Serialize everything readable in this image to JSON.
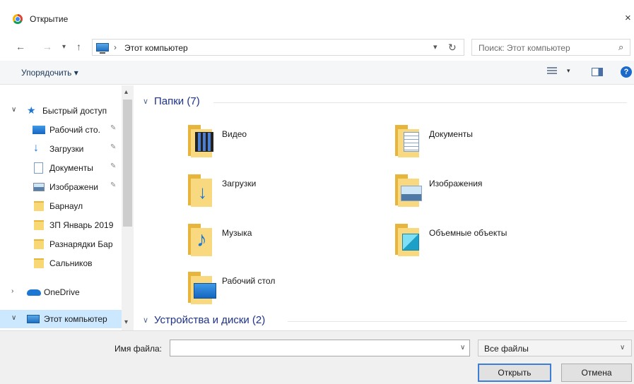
{
  "window": {
    "title": "Открытие",
    "close_glyph": "×"
  },
  "nav": {
    "back": "←",
    "forward": "→",
    "recent": "▾",
    "up": "↑"
  },
  "address": {
    "separator": "›",
    "crumb": "Этот компьютер",
    "chevron": "▾",
    "refresh": "↻"
  },
  "search": {
    "placeholder": "Поиск: Этот компьютер",
    "icon_glyph": "⌕"
  },
  "toolbar": {
    "organize_label": "Упорядочить ▾",
    "help_glyph": "?",
    "view_drop": "▾"
  },
  "sidebar": {
    "quick_access": {
      "label": "Быстрый доступ",
      "expander": "∨"
    },
    "items": [
      {
        "label": "Рабочий сто.",
        "icon": "desktop-icon",
        "pinned": true
      },
      {
        "label": "Загрузки",
        "icon": "downloads-icon",
        "pinned": true
      },
      {
        "label": "Документы",
        "icon": "documents-icon",
        "pinned": true
      },
      {
        "label": "Изображени",
        "icon": "pictures-icon",
        "pinned": true
      },
      {
        "label": "Барнаул",
        "icon": "folder-icon",
        "pinned": false
      },
      {
        "label": "ЗП Январь 2019",
        "icon": "folder-icon",
        "pinned": false
      },
      {
        "label": "Разнарядки Бар",
        "icon": "folder-icon",
        "pinned": false
      },
      {
        "label": "Сальников",
        "icon": "folder-icon",
        "pinned": false
      }
    ],
    "pin_glyph": "📌",
    "onedrive": {
      "label": "OneDrive",
      "expander": "›"
    },
    "this_pc": {
      "label": "Этот компьютер",
      "expander": "∨",
      "selected": true
    },
    "scroll_up": "▴",
    "scroll_down": "▾"
  },
  "content": {
    "folders_header": "Папки (7)",
    "devices_header": "Устройства и диски (2)",
    "collapse_glyph": "∨",
    "folders": [
      {
        "name": "Видео",
        "icon": "videos-folder-icon"
      },
      {
        "name": "Документы",
        "icon": "documents-folder-icon"
      },
      {
        "name": "Загрузки",
        "icon": "downloads-folder-icon"
      },
      {
        "name": "Изображения",
        "icon": "pictures-folder-icon"
      },
      {
        "name": "Музыка",
        "icon": "music-folder-icon"
      },
      {
        "name": "Объемные объекты",
        "icon": "3d-objects-folder-icon"
      },
      {
        "name": "Рабочий стол",
        "icon": "desktop-folder-icon"
      }
    ]
  },
  "footer": {
    "filename_label": "Имя файла:",
    "filename_value": "",
    "filename_chevron": "∨",
    "filter_value": "Все файлы",
    "filter_chevron": "∨",
    "open_label": "Открыть",
    "cancel_label": "Отмена"
  },
  "colors": {
    "accent": "#1e3287",
    "selection": "#cce8ff",
    "primary_border": "#3c7fd4"
  }
}
